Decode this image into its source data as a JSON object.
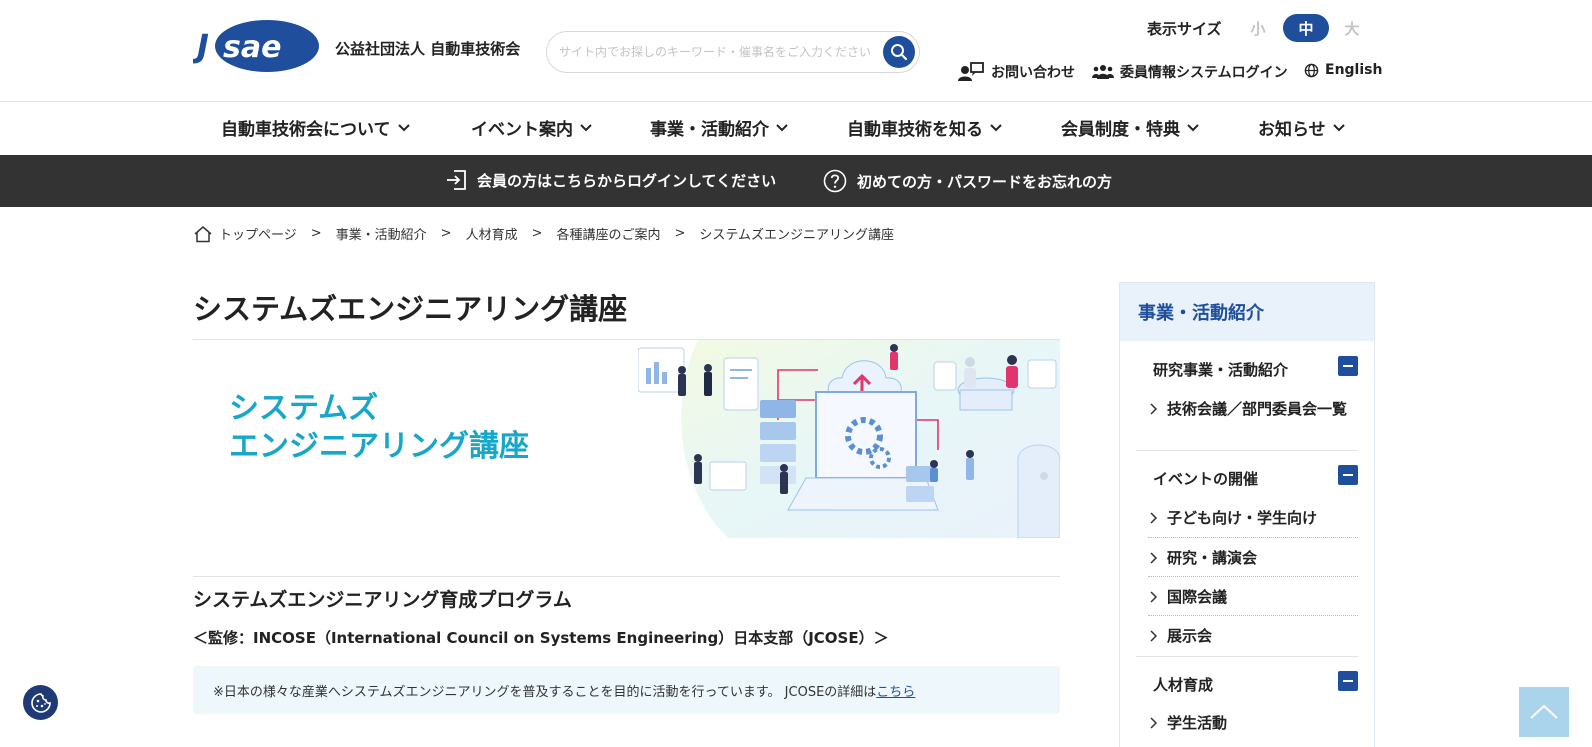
{
  "header": {
    "logo_text": "JSAE",
    "org_name": "公益社団法人 自動車技術会",
    "search_placeholder": "サイト内でお探しのキーワード・催事名をご入力ください",
    "font_size_label": "表示サイズ",
    "font_size_options": {
      "small": "小",
      "medium": "中",
      "large": "大"
    },
    "font_size_selected": "中",
    "links": {
      "contact": "お問い合わせ",
      "member_login": "委員情報システムログイン",
      "english": "English"
    }
  },
  "nav": {
    "items": [
      {
        "label": "自動車技術会について"
      },
      {
        "label": "イベント案内"
      },
      {
        "label": "事業・活動紹介"
      },
      {
        "label": "自動車技術を知る"
      },
      {
        "label": "会員制度・特典"
      },
      {
        "label": "お知らせ"
      }
    ]
  },
  "loginbar": {
    "login": "会員の方はこちらからログインしてください",
    "help": "初めての方・パスワードをお忘れの方"
  },
  "breadcrumb": {
    "items": [
      "トップページ",
      "事業・活動紹介",
      "人材育成",
      "各種講座のご案内",
      "システムズエンジニアリング講座"
    ],
    "separator": ">"
  },
  "main": {
    "title": "システムズエンジニアリング講座",
    "banner_line1": "システムズ",
    "banner_line2": "エンジニアリング講座",
    "section_title": "システムズエンジニアリング育成プログラム",
    "supervision": "＜監修：INCOSE（International Council on Systems Engineering）日本支部（JCOSE）＞",
    "note_text": "※日本の様々な産業へシステムズエンジニアリングを普及することを目的に活動を行っています。 JCOSEの詳細は",
    "note_link": "こちら"
  },
  "sidebar": {
    "heading": "事業・活動紹介",
    "groups": [
      {
        "label": "研究事業・活動紹介",
        "items": [
          "技術会議／部門委員会一覧"
        ]
      },
      {
        "label": "イベントの開催",
        "items": [
          "子ども向け・学生向け",
          "研究・講演会",
          "国際会議",
          "展示会"
        ]
      },
      {
        "label": "人材育成",
        "items": [
          "学生活動"
        ]
      }
    ]
  },
  "colors": {
    "brand": "#1f4e9c",
    "banner_text": "#17a7c9",
    "login_bar": "#333333",
    "side_head_bg": "#e9f2fb",
    "note_bg": "#eef8fc",
    "totop_bg": "#a9d4ec"
  },
  "icons": {
    "search": "magnifier-icon",
    "contact": "person-chat-icon",
    "member": "group-icon",
    "english": "globe-icon",
    "login": "login-arrow-icon",
    "help": "question-circle-icon",
    "home": "home-icon",
    "chevron": "chevron-down-icon",
    "cookie": "cookie-icon",
    "totop": "chevron-up-icon"
  }
}
